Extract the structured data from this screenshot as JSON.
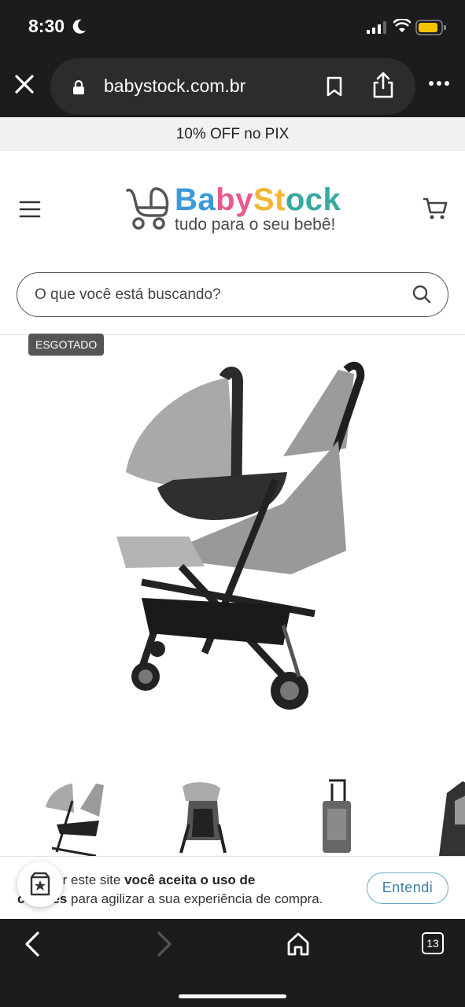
{
  "status": {
    "time": "8:30"
  },
  "browser": {
    "url": "babystock.com.br",
    "tabs_count": "13"
  },
  "promo": {
    "text": "10% OFF no PIX"
  },
  "header": {
    "brand": "BabyStock",
    "tagline": "tudo para o seu bebê!"
  },
  "search": {
    "placeholder": "O que você está buscando?"
  },
  "product": {
    "badge": "ESGOTADO"
  },
  "cookie": {
    "text_before": "egar por este site ",
    "text_bold1": "você aceita o uso de",
    "text_bold2": "cookies",
    "text_after": " para agilizar a sua experiência de compra.",
    "button": "Entendi"
  },
  "colors": {
    "browser_dark": "#1c1c1e",
    "logo_blue": "#3a9ad9",
    "logo_pink": "#e85a8e",
    "logo_yellow": "#f2b632",
    "logo_teal": "#36a9a0",
    "accent_button": "#6aa9c9"
  }
}
